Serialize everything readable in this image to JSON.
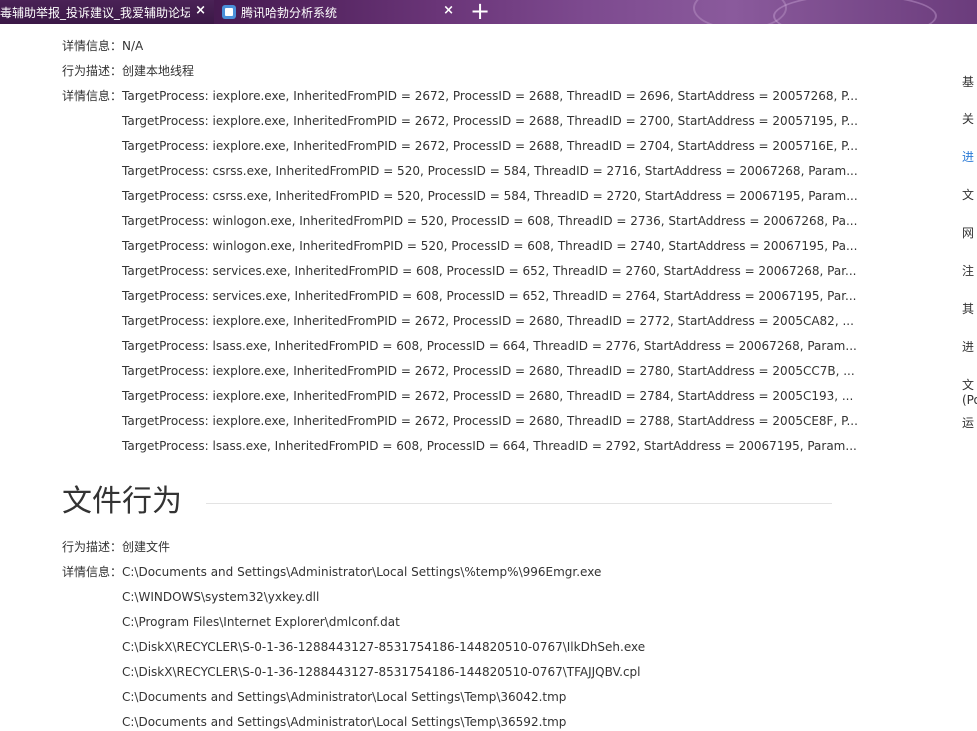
{
  "tabs": [
    {
      "label": "毒辅助举报_投诉建议_我爱辅助论坛",
      "close": "×"
    },
    {
      "label": "腾讯哈勃分析系统",
      "close": "×"
    }
  ],
  "new_tab": "+",
  "top": {
    "detail_label": "详情信息：",
    "detail_value": "N/A",
    "action_label": "行为描述：",
    "action_value": "创建本地线程",
    "detail2_label": "详情信息："
  },
  "threads": [
    "TargetProcess: iexplore.exe, InheritedFromPID = 2672, ProcessID = 2688, ThreadID = 2696, StartAddress = 20057268, P...",
    "TargetProcess: iexplore.exe, InheritedFromPID = 2672, ProcessID = 2688, ThreadID = 2700, StartAddress = 20057195, P...",
    "TargetProcess: iexplore.exe, InheritedFromPID = 2672, ProcessID = 2688, ThreadID = 2704, StartAddress = 2005716E, P...",
    "TargetProcess: csrss.exe, InheritedFromPID = 520, ProcessID = 584, ThreadID = 2716, StartAddress = 20067268, Param...",
    "TargetProcess: csrss.exe, InheritedFromPID = 520, ProcessID = 584, ThreadID = 2720, StartAddress = 20067195, Param...",
    "TargetProcess: winlogon.exe, InheritedFromPID = 520, ProcessID = 608, ThreadID = 2736, StartAddress = 20067268, Pa...",
    "TargetProcess: winlogon.exe, InheritedFromPID = 520, ProcessID = 608, ThreadID = 2740, StartAddress = 20067195, Pa...",
    "TargetProcess: services.exe, InheritedFromPID = 608, ProcessID = 652, ThreadID = 2760, StartAddress = 20067268, Par...",
    "TargetProcess: services.exe, InheritedFromPID = 608, ProcessID = 652, ThreadID = 2764, StartAddress = 20067195, Par...",
    "TargetProcess: iexplore.exe, InheritedFromPID = 2672, ProcessID = 2680, ThreadID = 2772, StartAddress = 2005CA82, ...",
    "TargetProcess: lsass.exe, InheritedFromPID = 608, ProcessID = 664, ThreadID = 2776, StartAddress = 20067268, Param...",
    "TargetProcess: iexplore.exe, InheritedFromPID = 2672, ProcessID = 2680, ThreadID = 2780, StartAddress = 2005CC7B, ...",
    "TargetProcess: iexplore.exe, InheritedFromPID = 2672, ProcessID = 2680, ThreadID = 2784, StartAddress = 2005C193, ...",
    "TargetProcess: iexplore.exe, InheritedFromPID = 2672, ProcessID = 2680, ThreadID = 2788, StartAddress = 2005CE8F, P...",
    "TargetProcess: lsass.exe, InheritedFromPID = 608, ProcessID = 664, ThreadID = 2792, StartAddress = 20067195, Param..."
  ],
  "file_section": {
    "title": "文件行为",
    "action_label": "行为描述：",
    "action_value": "创建文件",
    "detail_label": "详情信息：",
    "files": [
      "C:\\Documents and Settings\\Administrator\\Local Settings\\%temp%\\996Emgr.exe",
      "C:\\WINDOWS\\system32\\yxkey.dll",
      "C:\\Program Files\\Internet Explorer\\dmlconf.dat",
      "C:\\DiskX\\RECYCLER\\S-0-1-36-1288443127-8531754186-144820510-0767\\IlkDhSeh.exe",
      "C:\\DiskX\\RECYCLER\\S-0-1-36-1288443127-8531754186-144820510-0767\\TFAJJQBV.cpl",
      "C:\\Documents and Settings\\Administrator\\Local Settings\\Temp\\36042.tmp",
      "C:\\Documents and Settings\\Administrator\\Local Settings\\Temp\\36592.tmp"
    ]
  },
  "right_nav": [
    "基",
    "关",
    "进",
    "文",
    "网",
    "注",
    "其",
    "进",
    "文",
    "(Po",
    "运"
  ],
  "colors": {
    "accent": "#2a7ad6",
    "tab_bg": "#4a1d55"
  }
}
